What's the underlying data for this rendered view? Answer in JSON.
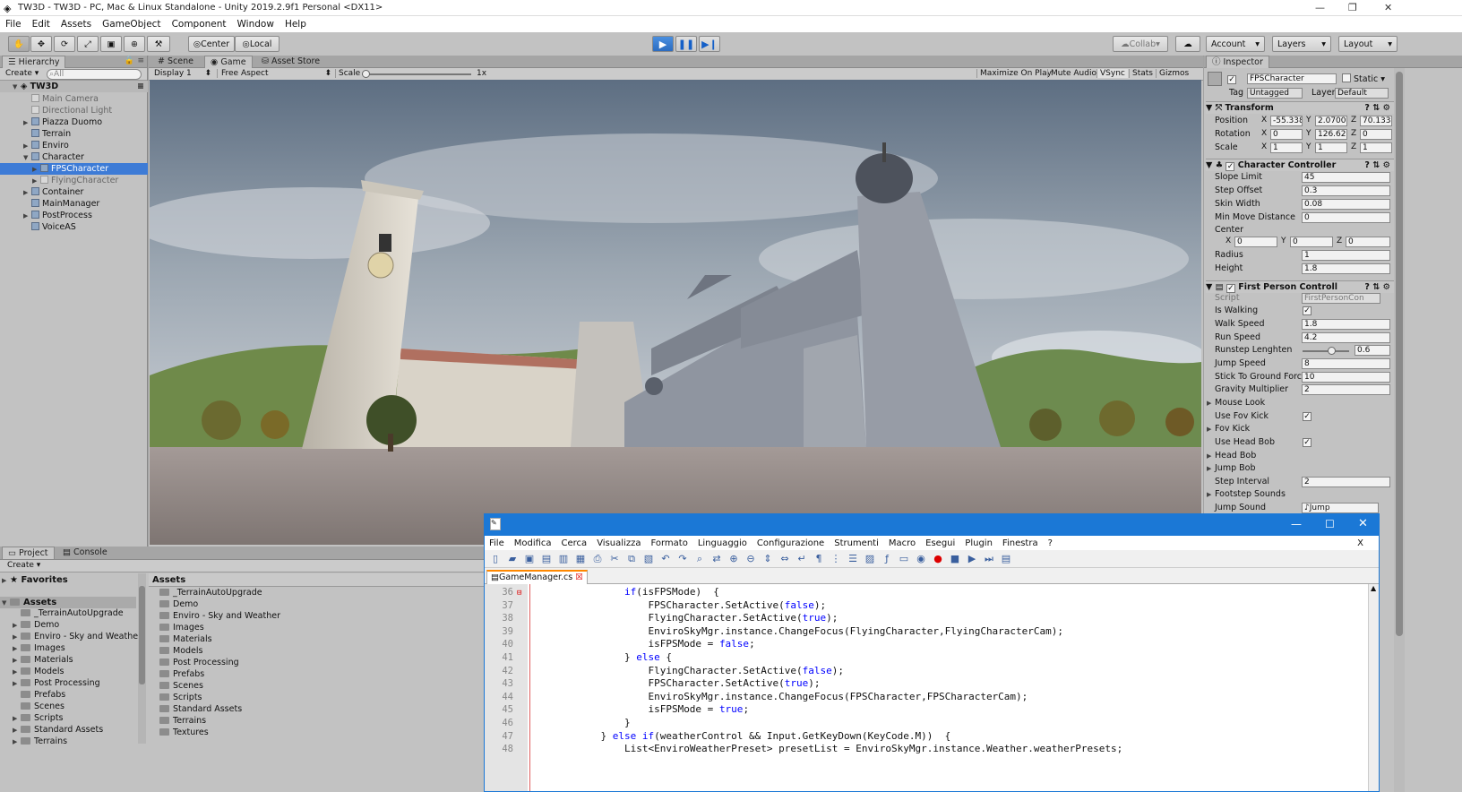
{
  "window": {
    "title": "TW3D - TW3D - PC, Mac & Linux Standalone - Unity 2019.2.9f1 Personal <DX11>"
  },
  "menu": [
    "File",
    "Edit",
    "Assets",
    "GameObject",
    "Component",
    "Window",
    "Help"
  ],
  "toolbar": {
    "center_label": "Center",
    "local_label": "Local",
    "collab_label": "Collab",
    "account_label": "Account",
    "layers_label": "Layers",
    "layout_label": "Layout"
  },
  "hierarchy": {
    "tab": "Hierarchy",
    "create": "Create",
    "search_placeholder": "All",
    "scene": "TW3D",
    "items": [
      {
        "label": "Main Camera",
        "depth": 1,
        "arrow": false,
        "dim": true
      },
      {
        "label": "Directional Light",
        "depth": 1,
        "arrow": false,
        "dim": true
      },
      {
        "label": "Piazza Duomo",
        "depth": 1,
        "arrow": true
      },
      {
        "label": "Terrain",
        "depth": 1,
        "arrow": false
      },
      {
        "label": "Enviro",
        "depth": 1,
        "arrow": true
      },
      {
        "label": "Character",
        "depth": 1,
        "arrow": "open"
      },
      {
        "label": "FPSCharacter",
        "depth": 2,
        "arrow": true,
        "selected": true
      },
      {
        "label": "FlyingCharacter",
        "depth": 2,
        "arrow": true,
        "dim": true
      },
      {
        "label": "Container",
        "depth": 1,
        "arrow": true
      },
      {
        "label": "MainManager",
        "depth": 1,
        "arrow": false
      },
      {
        "label": "PostProcess",
        "depth": 1,
        "arrow": true
      },
      {
        "label": "VoiceAS",
        "depth": 1,
        "arrow": false
      }
    ]
  },
  "game": {
    "tabs": [
      "Scene",
      "Game",
      "Asset Store"
    ],
    "display": "Display 1",
    "aspect": "Free Aspect",
    "scale_label": "Scale",
    "scale_value": "1x",
    "options": [
      "Maximize On Play",
      "Mute Audio",
      "VSync",
      "Stats",
      "Gizmos"
    ]
  },
  "inspector": {
    "tab": "Inspector",
    "object_name": "FPSCharacter",
    "static_label": "Static",
    "tag_label": "Tag",
    "tag_value": "Untagged",
    "layer_label": "Layer",
    "layer_value": "Default",
    "transform": {
      "title": "Transform",
      "rows": [
        {
          "label": "Position",
          "x": "-55.338",
          "y": "2.0700",
          "z": "70.1334"
        },
        {
          "label": "Rotation",
          "x": "0",
          "y": "126.62",
          "z": "0"
        },
        {
          "label": "Scale",
          "x": "1",
          "y": "1",
          "z": "1"
        }
      ]
    },
    "character_controller": {
      "title": "Character Controller",
      "slope_label": "Slope Limit",
      "slope": "45",
      "step_label": "Step Offset",
      "step": "0.3",
      "skin_label": "Skin Width",
      "skin": "0.08",
      "minmove_label": "Min Move Distance",
      "minmove": "0",
      "center_label": "Center",
      "cx": "0",
      "cy": "0",
      "cz": "0",
      "radius_label": "Radius",
      "radius": "1",
      "height_label": "Height",
      "height": "1.8"
    },
    "fps_controller": {
      "title": "First Person Controll",
      "script_label": "Script",
      "script": "FirstPersonCon",
      "walking_label": "Is Walking",
      "walk_label": "Walk Speed",
      "walk": "1.8",
      "run_label": "Run Speed",
      "run": "4.2",
      "runstep_label": "Runstep Lenghten",
      "runstep": "0.6",
      "jump_label": "Jump Speed",
      "jump": "8",
      "stick_label": "Stick To Ground Forc",
      "stick": "10",
      "gravity_label": "Gravity Multiplier",
      "gravity": "2",
      "mouse_label": "Mouse Look",
      "usefov_label": "Use Fov Kick",
      "fov_label": "Fov Kick",
      "usehead_label": "Use Head Bob",
      "head_label": "Head Bob",
      "jumpbob_label": "Jump Bob",
      "interval_label": "Step Interval",
      "interval": "2",
      "footstep_label": "Footstep Sounds",
      "jumpsound_label": "Jump Sound",
      "jumpsound": "Jump"
    }
  },
  "project": {
    "tabs": [
      "Project",
      "Console"
    ],
    "create": "Create",
    "favorites": "Favorites",
    "assets_root": "Assets",
    "tree": [
      "_TerrainAutoUpgrade",
      "Demo",
      "Enviro - Sky and Weathe",
      "Images",
      "Materials",
      "Models",
      "Post Processing",
      "Prefabs",
      "Scenes",
      "Scripts",
      "Standard Assets",
      "Terrains"
    ],
    "assets_header": "Assets",
    "folders": [
      "_TerrainAutoUpgrade",
      "Demo",
      "Enviro - Sky and Weather",
      "Images",
      "Materials",
      "Models",
      "Post Processing",
      "Prefabs",
      "Scenes",
      "Scripts",
      "Standard Assets",
      "Terrains",
      "Textures"
    ]
  },
  "notepad": {
    "menu": [
      "File",
      "Modifica",
      "Cerca",
      "Visualizza",
      "Formato",
      "Linguaggio",
      "Configurazione",
      "Strumenti",
      "Macro",
      "Esegui",
      "Plugin",
      "Finestra",
      "?"
    ],
    "close_doc": "X",
    "tab": "GameManager.cs",
    "lines": [
      {
        "n": "36",
        "indent": 16,
        "parts": [
          {
            "t": "if",
            "k": 1
          },
          {
            "t": "(isFPSMode)  {",
            "k": 0
          }
        ]
      },
      {
        "n": "37",
        "indent": 20,
        "parts": [
          {
            "t": "FPSCharacter.SetActive(",
            "k": 0
          },
          {
            "t": "false",
            "k": 1
          },
          {
            "t": ");",
            "k": 0
          }
        ]
      },
      {
        "n": "38",
        "indent": 20,
        "parts": [
          {
            "t": "FlyingCharacter.SetActive(",
            "k": 0
          },
          {
            "t": "true",
            "k": 1
          },
          {
            "t": ");",
            "k": 0
          }
        ]
      },
      {
        "n": "39",
        "indent": 20,
        "parts": [
          {
            "t": "EnviroSkyMgr.instance.ChangeFocus(FlyingCharacter,FlyingCharacterCam);",
            "k": 0
          }
        ]
      },
      {
        "n": "40",
        "indent": 20,
        "parts": [
          {
            "t": "isFPSMode = ",
            "k": 0
          },
          {
            "t": "false",
            "k": 1
          },
          {
            "t": ";",
            "k": 0
          }
        ]
      },
      {
        "n": "41",
        "indent": 16,
        "parts": [
          {
            "t": "} ",
            "k": 0
          },
          {
            "t": "else",
            "k": 1
          },
          {
            "t": " {",
            "k": 0
          }
        ]
      },
      {
        "n": "42",
        "indent": 20,
        "parts": [
          {
            "t": "FlyingCharacter.SetActive(",
            "k": 0
          },
          {
            "t": "false",
            "k": 1
          },
          {
            "t": ");",
            "k": 0
          }
        ]
      },
      {
        "n": "43",
        "indent": 20,
        "parts": [
          {
            "t": "FPSCharacter.SetActive(",
            "k": 0
          },
          {
            "t": "true",
            "k": 1
          },
          {
            "t": ");",
            "k": 0
          }
        ]
      },
      {
        "n": "44",
        "indent": 20,
        "parts": [
          {
            "t": "EnviroSkyMgr.instance.ChangeFocus(FPSCharacter,FPSCharacterCam);",
            "k": 0
          }
        ]
      },
      {
        "n": "45",
        "indent": 20,
        "parts": [
          {
            "t": "isFPSMode = ",
            "k": 0
          },
          {
            "t": "true",
            "k": 1
          },
          {
            "t": ";",
            "k": 0
          }
        ]
      },
      {
        "n": "46",
        "indent": 16,
        "parts": [
          {
            "t": "}",
            "k": 0
          }
        ]
      },
      {
        "n": "47",
        "indent": 12,
        "parts": [
          {
            "t": "} ",
            "k": 0
          },
          {
            "t": "else if",
            "k": 1
          },
          {
            "t": "(weatherControl && Input.GetKeyDown(KeyCode.M))  {",
            "k": 0
          }
        ]
      },
      {
        "n": "48",
        "indent": 16,
        "parts": [
          {
            "t": "List<EnviroWeatherPreset> presetList = EnviroSkyMgr.instance.Weather.weatherPresets;",
            "k": 0
          }
        ]
      }
    ]
  }
}
